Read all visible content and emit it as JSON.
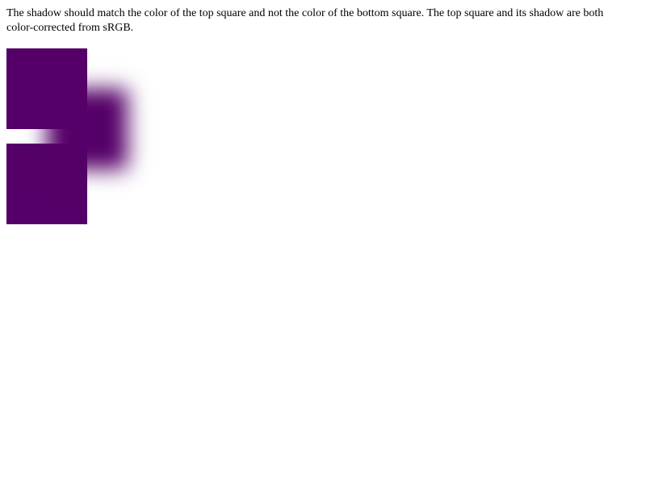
{
  "description": {
    "text": "The shadow should match the color of the top square and not the color of the bottom square. The top square and its shadow are both color-corrected from sRGB."
  },
  "colors": {
    "top_square": "#550068",
    "shadow": "#550068",
    "bottom_square": "#550068"
  }
}
